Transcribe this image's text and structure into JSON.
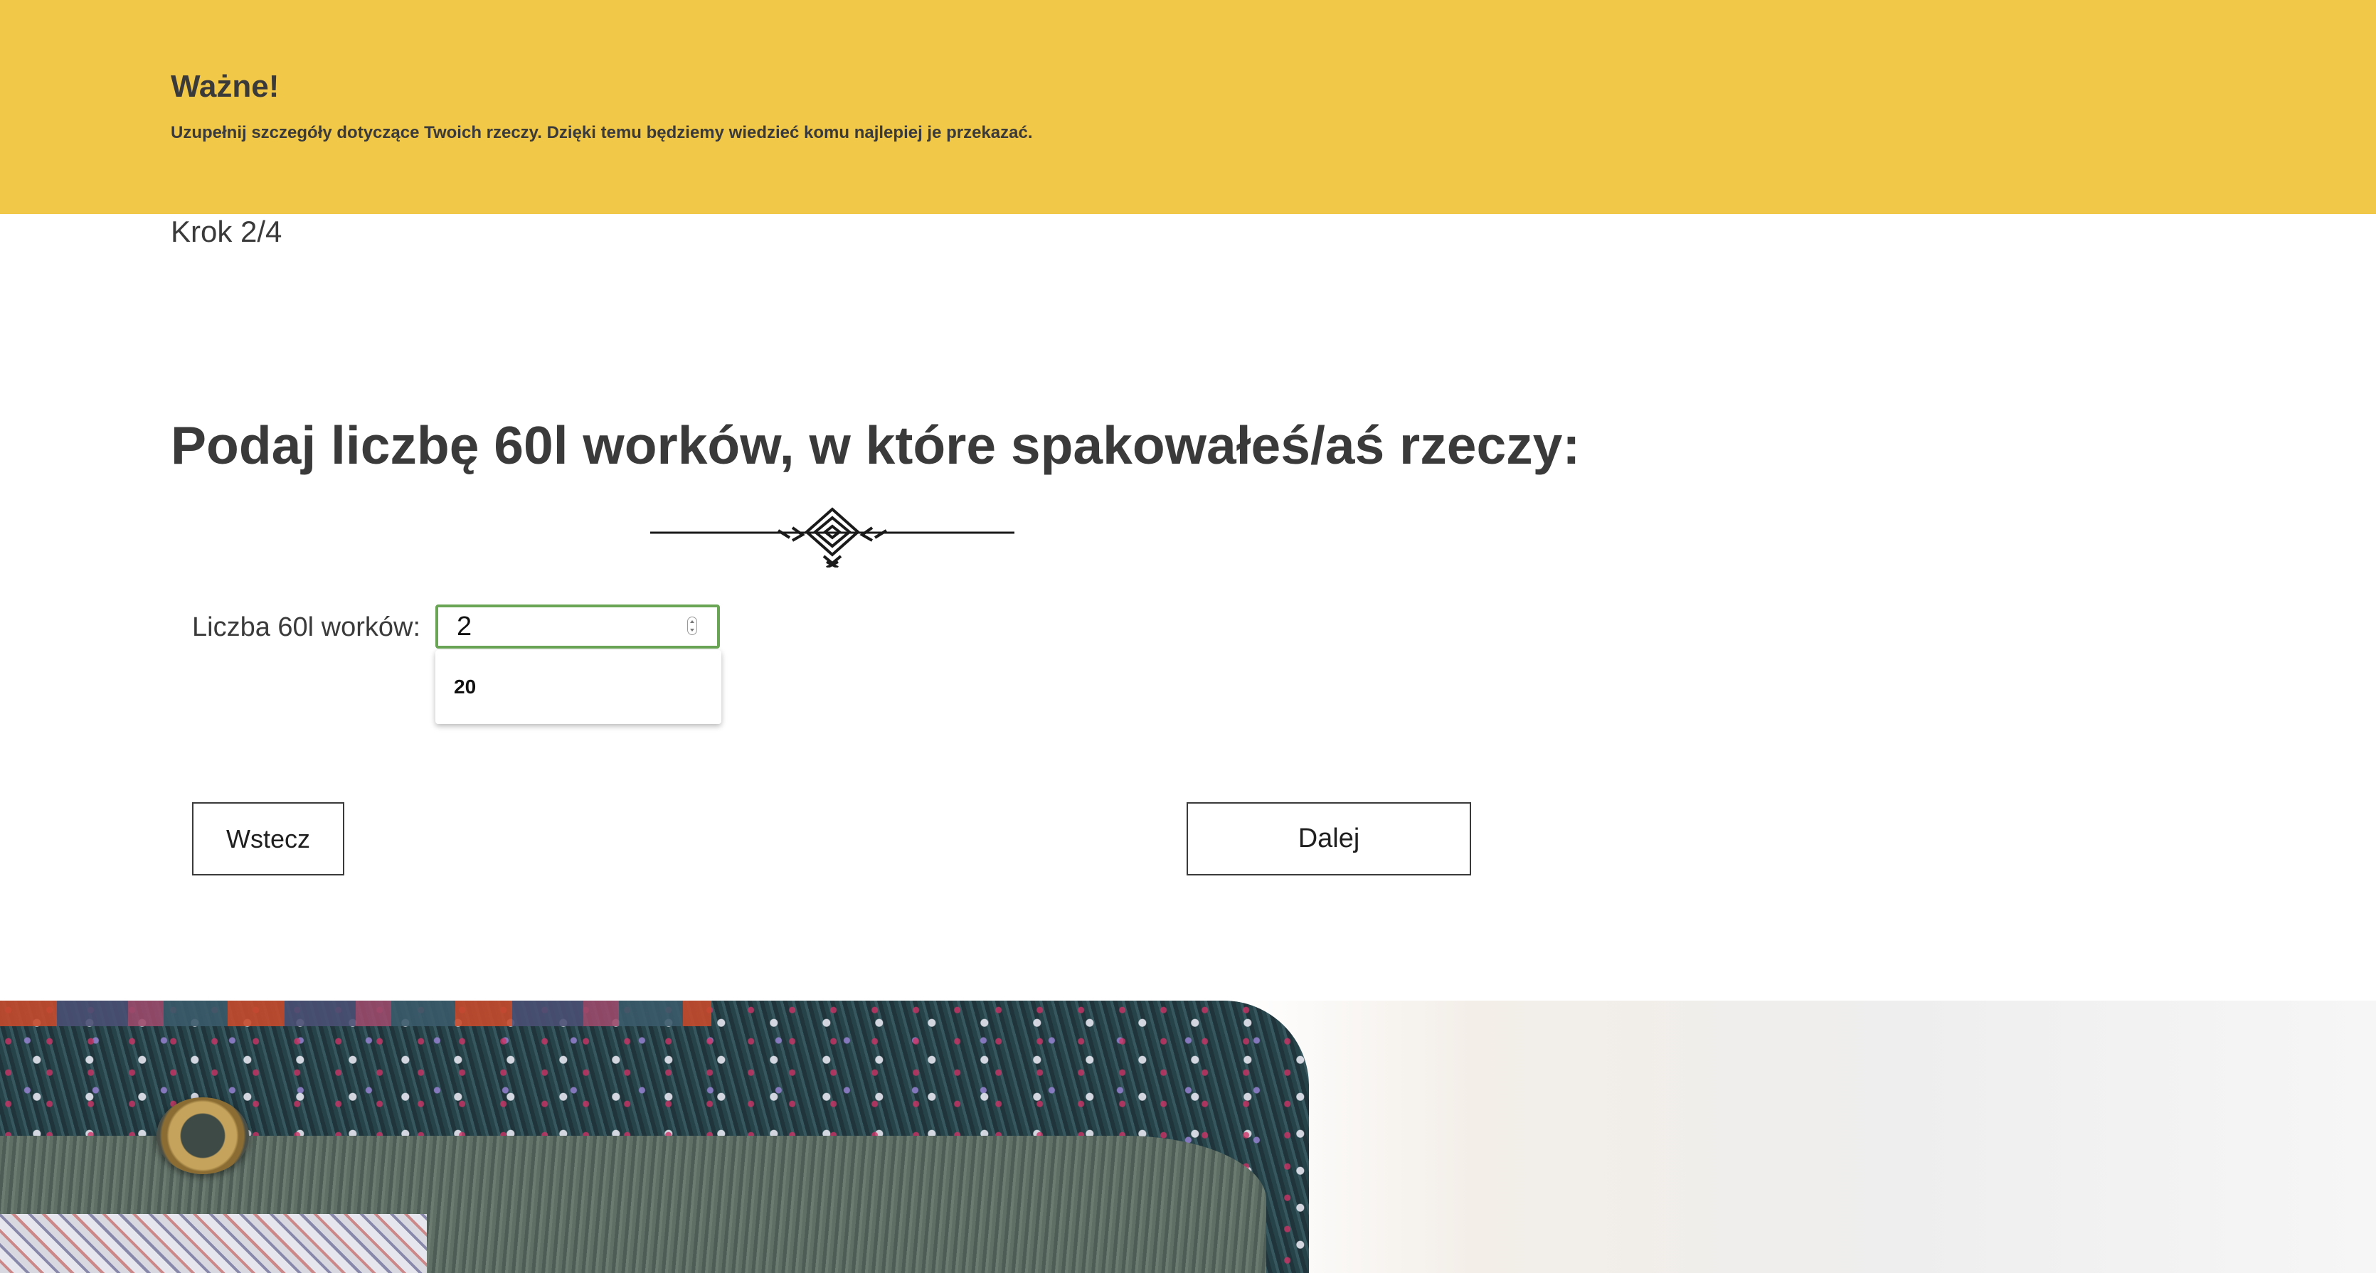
{
  "banner": {
    "title": "Ważne!",
    "text": "Uzupełnij szczegóły dotyczące Twoich rzeczy. Dzięki temu będziemy wiedzieć komu najlepiej je przekazać."
  },
  "step": {
    "label": "Krok 2/4"
  },
  "main": {
    "heading": "Podaj liczbę 60l worków, w które spakowałeś/aś rzeczy:"
  },
  "form": {
    "bags_label": "Liczba 60l worków:",
    "bags_value": "2",
    "autocomplete_options": [
      "20"
    ]
  },
  "buttons": {
    "back": "Wstecz",
    "next": "Dalej"
  },
  "colors": {
    "banner_background": "#f2c849",
    "input_focus_border": "#6aa556",
    "text": "#3a3a3a"
  },
  "icons": {
    "ornament": "decorative-divider-icon",
    "spinner": "number-spinner-icon"
  }
}
